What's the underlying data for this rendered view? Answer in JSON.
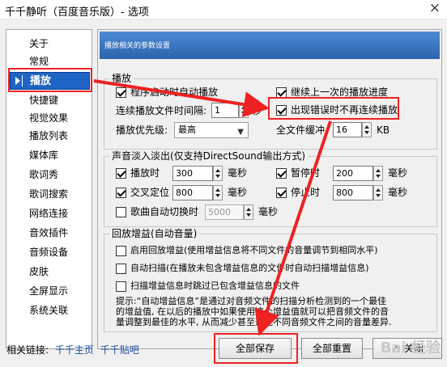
{
  "window": {
    "title": "千千静听（百度音乐版）- 选项",
    "close_icon": "close-icon"
  },
  "sidebar": {
    "items": [
      {
        "label": "关于"
      },
      {
        "label": "常规"
      },
      {
        "label": "播放"
      },
      {
        "label": "快捷键"
      },
      {
        "label": "视觉效果"
      },
      {
        "label": "播放列表"
      },
      {
        "label": "媒体库"
      },
      {
        "label": "歌词秀"
      },
      {
        "label": "歌词搜索"
      },
      {
        "label": "网络连接"
      },
      {
        "label": "音效插件"
      },
      {
        "label": "音频设备"
      },
      {
        "label": "皮肤"
      },
      {
        "label": "全屏显示"
      },
      {
        "label": "系统关联"
      }
    ],
    "active": "播放"
  },
  "panel": {
    "header": "播放相关的参数设置",
    "playback": {
      "legend": "播放",
      "auto_play": {
        "label": "程序启动时自动播放",
        "checked": true
      },
      "resume": {
        "label": "继续上一次的播放进度",
        "checked": true
      },
      "interval_label": "连续播放文件时间隔:",
      "interval_value": "1",
      "interval_unit": "秒",
      "no_continue_on_error": {
        "label": "出现错误时不再连续播放",
        "checked": true
      },
      "priority_label": "播放优先级:",
      "priority_value": "最高",
      "buffer_label": "全文件缓冲",
      "buffer_value": "16",
      "buffer_unit": "KB"
    },
    "fade": {
      "legend": "声音淡入淡出(仅支持DirectSound输出方式)",
      "play": {
        "label": "播放时",
        "checked": true,
        "value": "300",
        "unit": "毫秒"
      },
      "pause": {
        "label": "暂停时",
        "checked": true,
        "value": "200",
        "unit": "毫秒"
      },
      "cross": {
        "label": "交叉定位",
        "checked": true,
        "value": "800",
        "unit": "毫秒"
      },
      "stop": {
        "label": "停止时",
        "checked": true,
        "value": "800",
        "unit": "毫秒"
      },
      "lyric_switch": {
        "label": "歌曲自动切换时",
        "checked": false,
        "value": "5000",
        "unit": "毫秒"
      }
    },
    "replaygain": {
      "legend": "回放增益(自动音量)",
      "enable": {
        "label": "启用回放增益(使用增益信息将不同文件的音量调节到相同水平)",
        "checked": false
      },
      "auto_scan": {
        "label": "自动扫描(在播放未包含增益信息的文件时自动扫描增益信息)",
        "checked": false
      },
      "skip_scan": {
        "label": "扫描增益信息时跳过已包含增益信息的文件",
        "checked": false
      },
      "hint_line1": "提示:“自动增益信息”是通过对音频文件的扫描分析检测到的一个最佳",
      "hint_line2": "的增益值, 在以后的播放中如果使用这个增益值就可以把音频文件的音",
      "hint_line3": "量调整到最佳的水平, 从而减少甚至避免不同音频文件之间的音量差异."
    }
  },
  "footer": {
    "links_label": "相关链接:",
    "link_home": "千千主页",
    "link_tieba": "千千贴吧",
    "save_all": "全部保存",
    "reset_all": "全部重置",
    "close": "关闭"
  },
  "watermark": "Bai 经验",
  "colors": {
    "accent": "#1f64c4",
    "annotation": "#e22222",
    "header_gradient_top": "#4d8bd6"
  }
}
